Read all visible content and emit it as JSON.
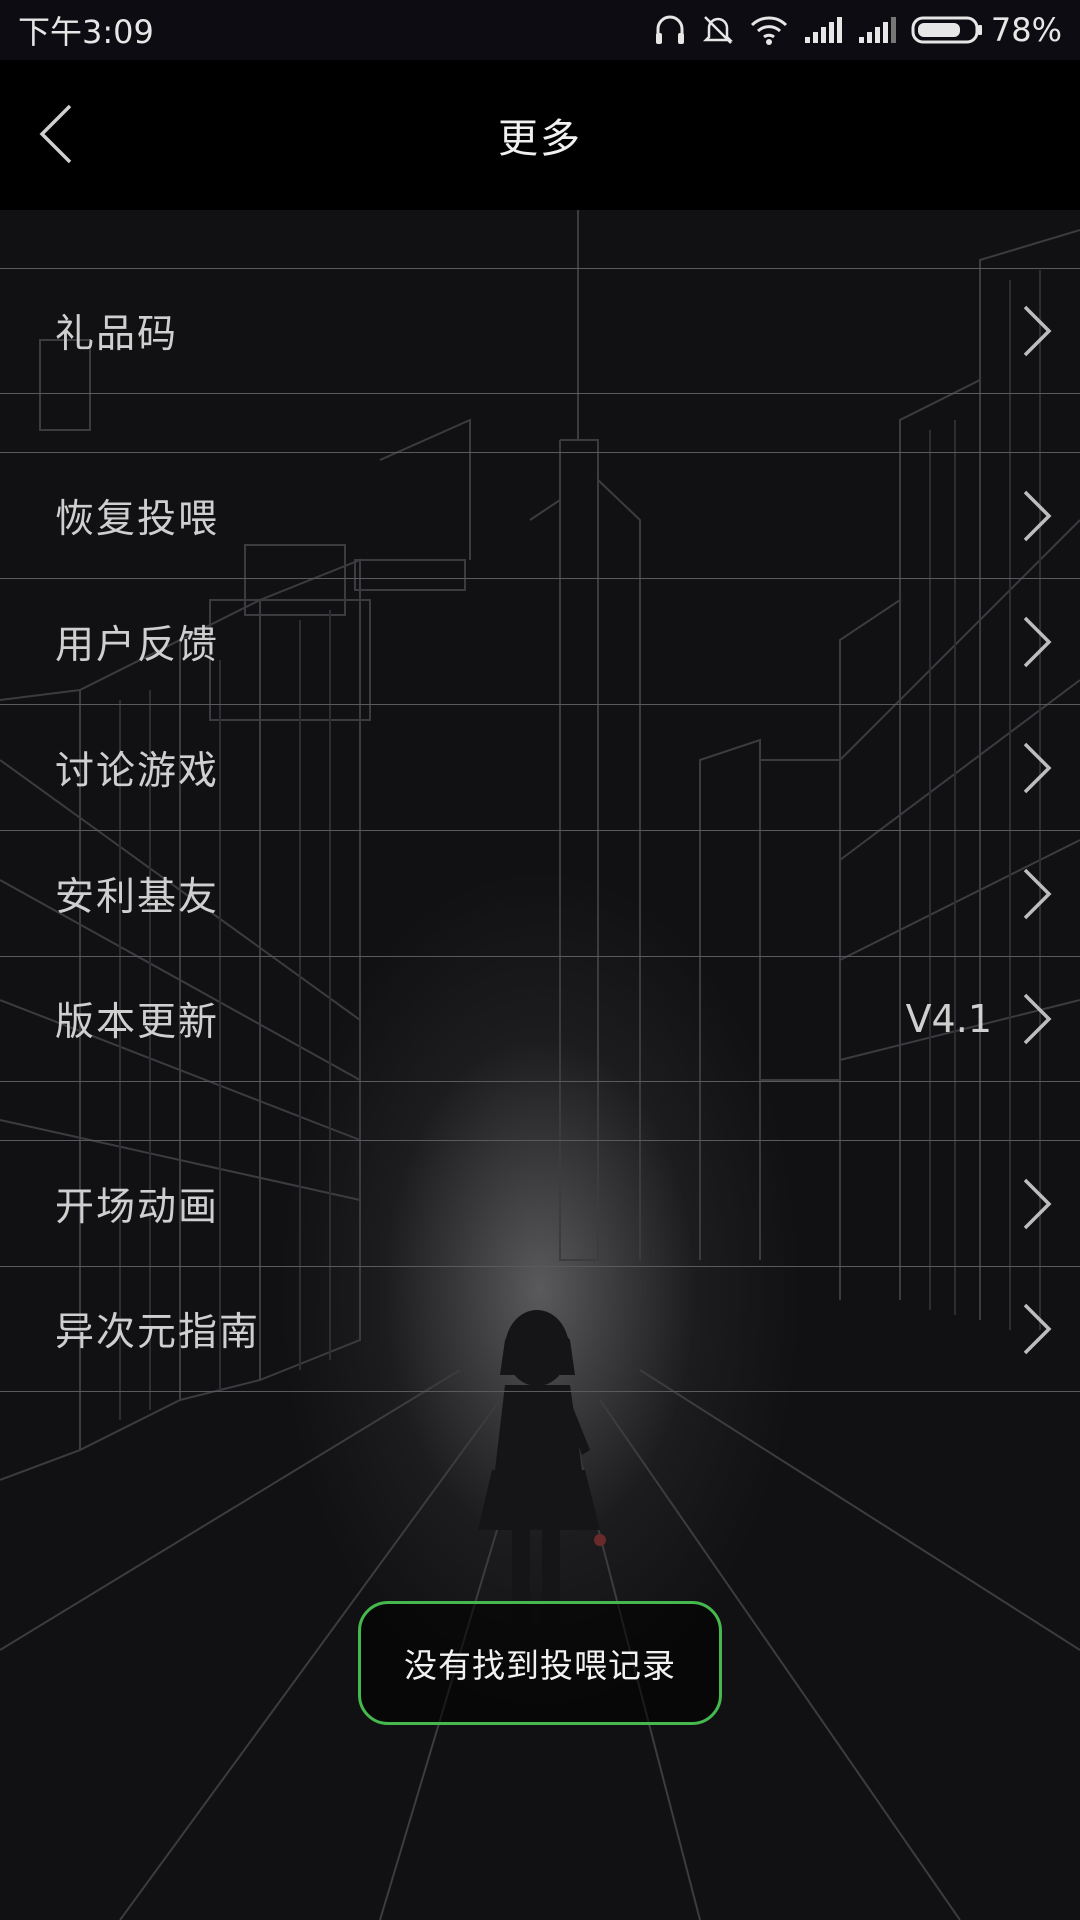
{
  "status_bar": {
    "time": "下午3:09",
    "battery_percent": "78%",
    "battery_level": 0.78,
    "icons": [
      "headphones-icon",
      "bell-muted-icon",
      "wifi-icon",
      "signal-icon",
      "signal-icon",
      "battery-icon"
    ]
  },
  "nav": {
    "title": "更多",
    "back_icon": "chevron-left-icon"
  },
  "menu": {
    "group1": [
      {
        "label": "礼品码"
      }
    ],
    "group2": [
      {
        "label": "恢复投喂"
      },
      {
        "label": "用户反馈"
      },
      {
        "label": "讨论游戏"
      },
      {
        "label": "安利基友"
      },
      {
        "label": "版本更新",
        "value": "V4.1"
      }
    ],
    "group3": [
      {
        "label": "开场动画"
      },
      {
        "label": "异次元指南"
      }
    ]
  },
  "toast": {
    "message": "没有找到投喂记录"
  },
  "colors": {
    "toast_border": "#45b84e",
    "divider": "#5a5a5e",
    "nav_bg": "#000000"
  }
}
